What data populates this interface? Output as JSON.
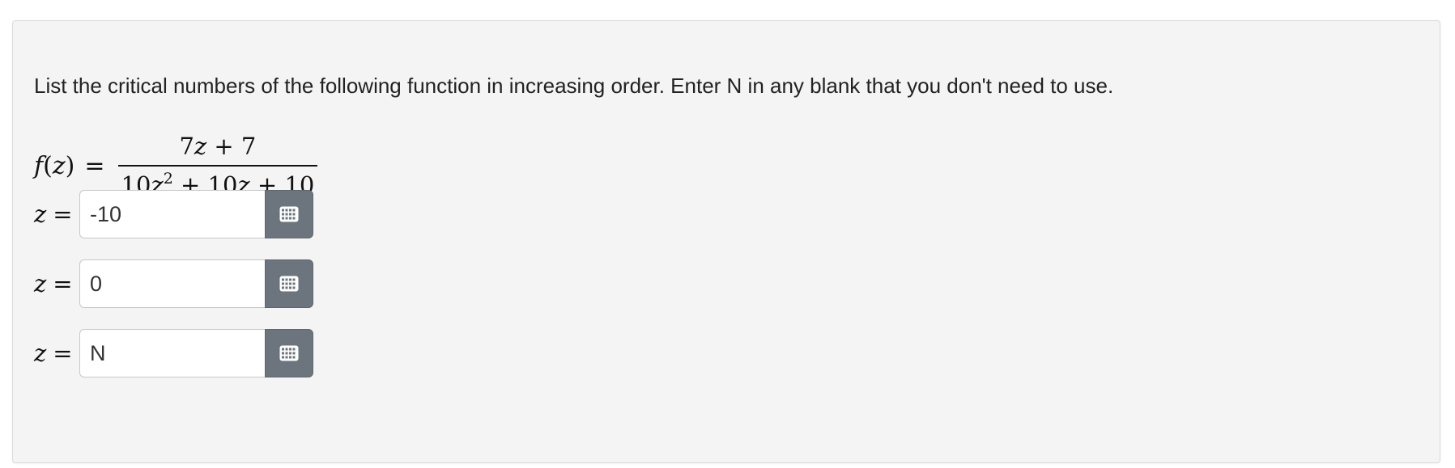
{
  "question": {
    "instructions": "List the critical numbers of the following function in increasing order. Enter N in any blank that you don't need to use."
  },
  "formula": {
    "lhs_func": "f",
    "lhs_open": "(",
    "lhs_var": "z",
    "lhs_close": ")",
    "equals": "=",
    "numerator": {
      "coef": "7",
      "var": "z",
      "rest": " + 7"
    },
    "denominator": {
      "coef1": "10",
      "var1": "z",
      "exp": "2",
      "mid": " + 10",
      "var2": "z",
      "rest": " + 10"
    }
  },
  "answers": [
    {
      "variable": "z",
      "equals": "=",
      "value": "-10"
    },
    {
      "variable": "z",
      "equals": "=",
      "value": "0"
    },
    {
      "variable": "z",
      "equals": "=",
      "value": "N"
    }
  ],
  "icons": {
    "keyboard_button": "keyboard-icon"
  },
  "colors": {
    "card_background": "#f4f4f4",
    "button_background": "#6c757d"
  }
}
